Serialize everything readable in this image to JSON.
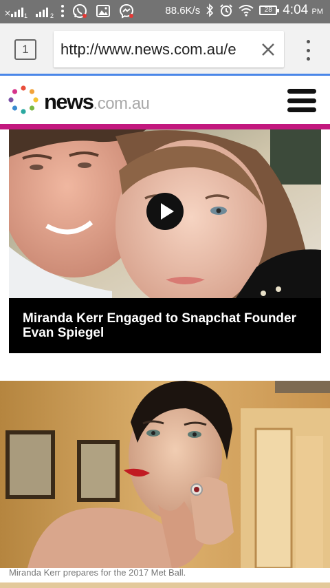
{
  "status_bar": {
    "signal_sim1_sub": "1",
    "signal_sim2_sub": "2",
    "network_speed": "88.6K/s",
    "battery_level": "28",
    "time": "4:04",
    "time_period": "PM"
  },
  "browser": {
    "tab_count": "1",
    "url": "http://www.news.com.au/e"
  },
  "site": {
    "logo_bold": "news",
    "logo_light": ".com.au",
    "accent_color": "#c2187e"
  },
  "articles": [
    {
      "headline": "Miranda Kerr Engaged to Snapchat Founder Evan Spiegel",
      "has_video": true
    },
    {
      "caption": "Miranda Kerr prepares for the 2017 Met Ball."
    }
  ]
}
